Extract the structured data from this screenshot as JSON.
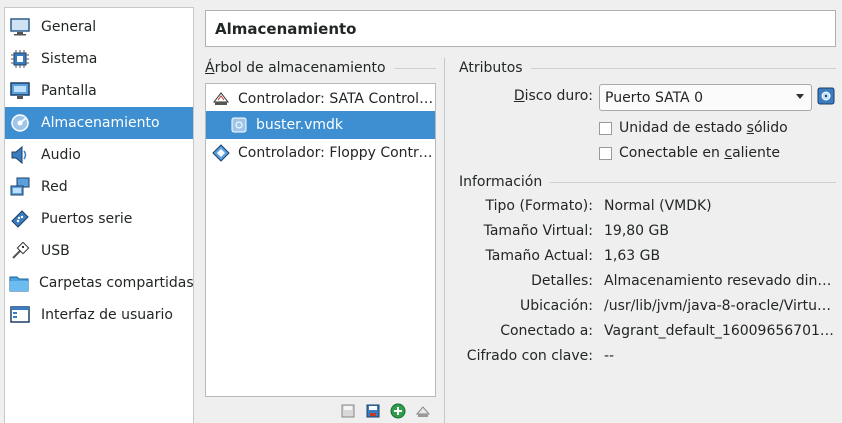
{
  "page_title": "Almacenamiento",
  "sidebar": {
    "items": [
      {
        "label": "General",
        "icon": "monitor-icon"
      },
      {
        "label": "Sistema",
        "icon": "chip-icon"
      },
      {
        "label": "Pantalla",
        "icon": "display-icon"
      },
      {
        "label": "Almacenamiento",
        "icon": "disk-icon",
        "selected": true
      },
      {
        "label": "Audio",
        "icon": "speaker-icon"
      },
      {
        "label": "Red",
        "icon": "network-icon"
      },
      {
        "label": "Puertos serie",
        "icon": "serial-port-icon"
      },
      {
        "label": "USB",
        "icon": "usb-icon"
      },
      {
        "label": "Carpetas compartidas",
        "icon": "folder-icon"
      },
      {
        "label": "Interfaz de usuario",
        "icon": "window-icon"
      }
    ]
  },
  "tree": {
    "heading_first": "Á",
    "heading_rest": "rbol de almacenamiento",
    "rows": [
      {
        "label": "Controlador: SATA Controll…",
        "icon": "sata-controller-icon"
      },
      {
        "label": "buster.vmdk",
        "icon": "hard-disk-icon",
        "selected": true
      },
      {
        "label": "Controlador: Floppy Control…",
        "icon": "floppy-controller-icon"
      }
    ],
    "tools": [
      "remove-attachment-icon",
      "add-attachment-icon",
      "add-controller-icon",
      "remove-controller-icon"
    ]
  },
  "attributes": {
    "heading": "Atributos",
    "disk_label_first": "D",
    "disk_label_rest": "isco duro:",
    "disk_value": "Puerto SATA 0",
    "ssd_label_pre": "Unidad de estado ",
    "ssd_label_key": "s",
    "ssd_label_post": "ólido",
    "hotplug_label_pre": "Conectable en ",
    "hotplug_label_key": "c",
    "hotplug_label_post": "aliente"
  },
  "info": {
    "heading": "Información",
    "rows": [
      {
        "key": "Tipo (Formato):",
        "value": "Normal (VMDK)"
      },
      {
        "key": "Tamaño Virtual:",
        "value": "19,80 GB"
      },
      {
        "key": "Tamaño Actual:",
        "value": "1,63 GB"
      },
      {
        "key": "Detalles:",
        "value": "Almacenamiento resevado dinám…"
      },
      {
        "key": "Ubicación:",
        "value": "/usr/lib/jvm/java-8-oracle/Virtual…"
      },
      {
        "key": "Conectado a:",
        "value": "Vagrant_default_160096567016…"
      },
      {
        "key": "Cifrado con clave:",
        "value": "--"
      }
    ]
  },
  "colors": {
    "selection": "#3d8fd2",
    "background": "#efefef"
  }
}
